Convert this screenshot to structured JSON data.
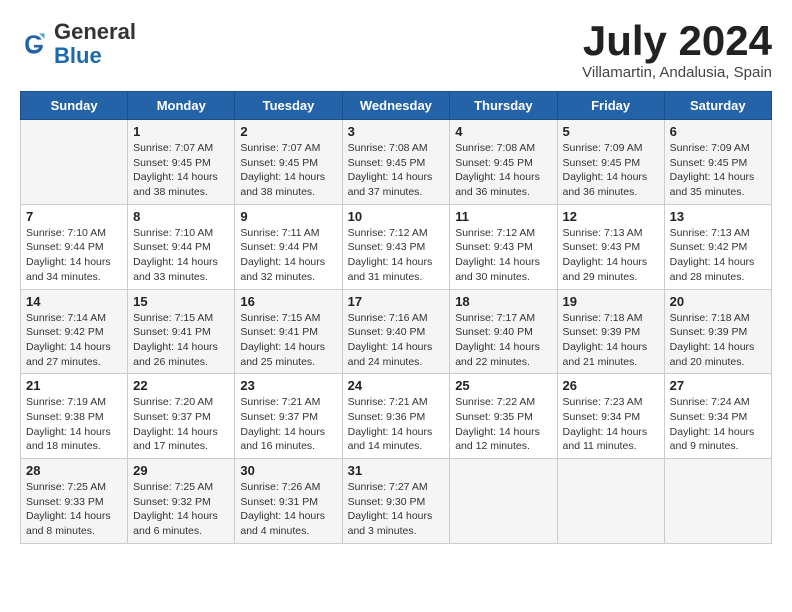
{
  "header": {
    "logo_general": "General",
    "logo_blue": "Blue",
    "month_title": "July 2024",
    "location": "Villamartin, Andalusia, Spain"
  },
  "calendar": {
    "days_of_week": [
      "Sunday",
      "Monday",
      "Tuesday",
      "Wednesday",
      "Thursday",
      "Friday",
      "Saturday"
    ],
    "weeks": [
      [
        {
          "day": "",
          "info": ""
        },
        {
          "day": "1",
          "info": "Sunrise: 7:07 AM\nSunset: 9:45 PM\nDaylight: 14 hours\nand 38 minutes."
        },
        {
          "day": "2",
          "info": "Sunrise: 7:07 AM\nSunset: 9:45 PM\nDaylight: 14 hours\nand 38 minutes."
        },
        {
          "day": "3",
          "info": "Sunrise: 7:08 AM\nSunset: 9:45 PM\nDaylight: 14 hours\nand 37 minutes."
        },
        {
          "day": "4",
          "info": "Sunrise: 7:08 AM\nSunset: 9:45 PM\nDaylight: 14 hours\nand 36 minutes."
        },
        {
          "day": "5",
          "info": "Sunrise: 7:09 AM\nSunset: 9:45 PM\nDaylight: 14 hours\nand 36 minutes."
        },
        {
          "day": "6",
          "info": "Sunrise: 7:09 AM\nSunset: 9:45 PM\nDaylight: 14 hours\nand 35 minutes."
        }
      ],
      [
        {
          "day": "7",
          "info": "Sunrise: 7:10 AM\nSunset: 9:44 PM\nDaylight: 14 hours\nand 34 minutes."
        },
        {
          "day": "8",
          "info": "Sunrise: 7:10 AM\nSunset: 9:44 PM\nDaylight: 14 hours\nand 33 minutes."
        },
        {
          "day": "9",
          "info": "Sunrise: 7:11 AM\nSunset: 9:44 PM\nDaylight: 14 hours\nand 32 minutes."
        },
        {
          "day": "10",
          "info": "Sunrise: 7:12 AM\nSunset: 9:43 PM\nDaylight: 14 hours\nand 31 minutes."
        },
        {
          "day": "11",
          "info": "Sunrise: 7:12 AM\nSunset: 9:43 PM\nDaylight: 14 hours\nand 30 minutes."
        },
        {
          "day": "12",
          "info": "Sunrise: 7:13 AM\nSunset: 9:43 PM\nDaylight: 14 hours\nand 29 minutes."
        },
        {
          "day": "13",
          "info": "Sunrise: 7:13 AM\nSunset: 9:42 PM\nDaylight: 14 hours\nand 28 minutes."
        }
      ],
      [
        {
          "day": "14",
          "info": "Sunrise: 7:14 AM\nSunset: 9:42 PM\nDaylight: 14 hours\nand 27 minutes."
        },
        {
          "day": "15",
          "info": "Sunrise: 7:15 AM\nSunset: 9:41 PM\nDaylight: 14 hours\nand 26 minutes."
        },
        {
          "day": "16",
          "info": "Sunrise: 7:15 AM\nSunset: 9:41 PM\nDaylight: 14 hours\nand 25 minutes."
        },
        {
          "day": "17",
          "info": "Sunrise: 7:16 AM\nSunset: 9:40 PM\nDaylight: 14 hours\nand 24 minutes."
        },
        {
          "day": "18",
          "info": "Sunrise: 7:17 AM\nSunset: 9:40 PM\nDaylight: 14 hours\nand 22 minutes."
        },
        {
          "day": "19",
          "info": "Sunrise: 7:18 AM\nSunset: 9:39 PM\nDaylight: 14 hours\nand 21 minutes."
        },
        {
          "day": "20",
          "info": "Sunrise: 7:18 AM\nSunset: 9:39 PM\nDaylight: 14 hours\nand 20 minutes."
        }
      ],
      [
        {
          "day": "21",
          "info": "Sunrise: 7:19 AM\nSunset: 9:38 PM\nDaylight: 14 hours\nand 18 minutes."
        },
        {
          "day": "22",
          "info": "Sunrise: 7:20 AM\nSunset: 9:37 PM\nDaylight: 14 hours\nand 17 minutes."
        },
        {
          "day": "23",
          "info": "Sunrise: 7:21 AM\nSunset: 9:37 PM\nDaylight: 14 hours\nand 16 minutes."
        },
        {
          "day": "24",
          "info": "Sunrise: 7:21 AM\nSunset: 9:36 PM\nDaylight: 14 hours\nand 14 minutes."
        },
        {
          "day": "25",
          "info": "Sunrise: 7:22 AM\nSunset: 9:35 PM\nDaylight: 14 hours\nand 12 minutes."
        },
        {
          "day": "26",
          "info": "Sunrise: 7:23 AM\nSunset: 9:34 PM\nDaylight: 14 hours\nand 11 minutes."
        },
        {
          "day": "27",
          "info": "Sunrise: 7:24 AM\nSunset: 9:34 PM\nDaylight: 14 hours\nand 9 minutes."
        }
      ],
      [
        {
          "day": "28",
          "info": "Sunrise: 7:25 AM\nSunset: 9:33 PM\nDaylight: 14 hours\nand 8 minutes."
        },
        {
          "day": "29",
          "info": "Sunrise: 7:25 AM\nSunset: 9:32 PM\nDaylight: 14 hours\nand 6 minutes."
        },
        {
          "day": "30",
          "info": "Sunrise: 7:26 AM\nSunset: 9:31 PM\nDaylight: 14 hours\nand 4 minutes."
        },
        {
          "day": "31",
          "info": "Sunrise: 7:27 AM\nSunset: 9:30 PM\nDaylight: 14 hours\nand 3 minutes."
        },
        {
          "day": "",
          "info": ""
        },
        {
          "day": "",
          "info": ""
        },
        {
          "day": "",
          "info": ""
        }
      ]
    ]
  }
}
